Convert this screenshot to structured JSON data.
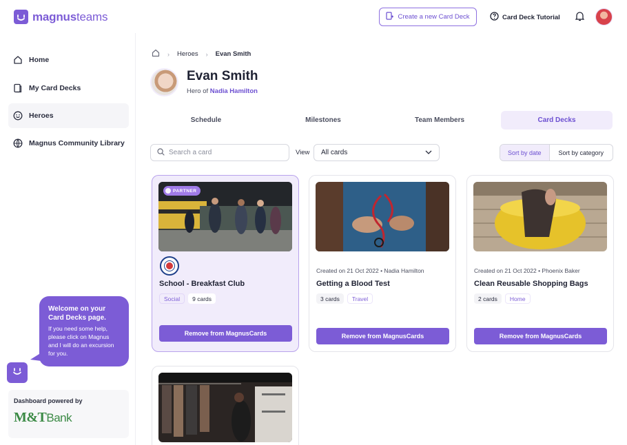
{
  "brand": {
    "name_bold": "magnus",
    "name_light": "teams"
  },
  "header": {
    "create_button": "Create a new Card Deck",
    "tutorial": "Card Deck Tutorial"
  },
  "sidebar": {
    "items": [
      {
        "label": "Home",
        "icon": "home-icon"
      },
      {
        "label": "My Card Decks",
        "icon": "card-deck-icon"
      },
      {
        "label": "Heroes",
        "icon": "smiley-icon"
      },
      {
        "label": "Magnus Community Library",
        "icon": "globe-icon"
      }
    ],
    "active": "Heroes",
    "help_bubble": {
      "title": "Welcome on your Card Decks page.",
      "text": "If you need some help, please click on Magnus and I will do an excursion for you."
    },
    "powered_by": {
      "label": "Dashboard powered by",
      "logo_text": "M&T",
      "logo_suffix": "Bank"
    }
  },
  "breadcrumb": {
    "parent": "Heroes",
    "current": "Evan Smith"
  },
  "profile": {
    "name": "Evan Smith",
    "subtitle_prefix": "Hero of",
    "subtitle_link": "Nadia Hamilton"
  },
  "tabs": [
    {
      "label": "Schedule"
    },
    {
      "label": "Milestones"
    },
    {
      "label": "Team Members"
    },
    {
      "label": "Card Decks"
    }
  ],
  "active_tab": "Card Decks",
  "filters": {
    "search_placeholder": "Search a card",
    "view_label": "View",
    "view_value": "All cards",
    "sort_by_date": "Sort by date",
    "sort_by_category": "Sort by category"
  },
  "cards": [
    {
      "badge": "PARTNER",
      "meta": "",
      "title": "School - Breakfast Club",
      "tags": [
        "Social",
        "9 cards"
      ],
      "button": "Remove from MagnusCards"
    },
    {
      "badge": "",
      "meta": "Created on 21 Oct 2022 • Nadia Hamilton",
      "title": "Getting a Blood Test",
      "tags": [
        "3 cards",
        "Travel"
      ],
      "button": "Remove from MagnusCards"
    },
    {
      "badge": "",
      "meta": "Created on 21 Oct 2022 • Phoenix Baker",
      "title": "Clean Reusable Shopping Bags",
      "tags": [
        "2 cards",
        "Home"
      ],
      "button": "Remove from MagnusCards"
    }
  ],
  "colors": {
    "accent": "#7c5cd6",
    "accent_light": "#f1ecfb"
  }
}
